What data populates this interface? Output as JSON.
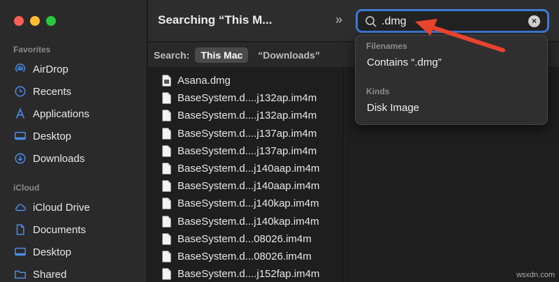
{
  "sidebar": {
    "sections": [
      {
        "title": "Favorites",
        "items": [
          {
            "label": "AirDrop",
            "icon": "airdrop-icon"
          },
          {
            "label": "Recents",
            "icon": "clock-icon"
          },
          {
            "label": "Applications",
            "icon": "applications-icon"
          },
          {
            "label": "Desktop",
            "icon": "desktop-icon"
          },
          {
            "label": "Downloads",
            "icon": "downloads-icon"
          }
        ]
      },
      {
        "title": "iCloud",
        "items": [
          {
            "label": "iCloud Drive",
            "icon": "cloud-icon"
          },
          {
            "label": "Documents",
            "icon": "document-icon"
          },
          {
            "label": "Desktop",
            "icon": "desktop-icon"
          },
          {
            "label": "Shared",
            "icon": "shared-folder-icon"
          }
        ]
      }
    ]
  },
  "toolbar": {
    "title": "Searching “This M...",
    "overflow_glyph": "»",
    "search": {
      "value": ".dmg",
      "clear_glyph": "×"
    }
  },
  "scope": {
    "label": "Search:",
    "options": [
      {
        "label": "This Mac",
        "selected": true
      },
      {
        "label": "“Downloads”",
        "selected": false
      }
    ]
  },
  "files": [
    "Asana.dmg",
    "BaseSystem.d....j132ap.im4m",
    "BaseSystem.d....j132ap.im4m",
    "BaseSystem.d....j137ap.im4m",
    "BaseSystem.d....j137ap.im4m",
    "BaseSystem.d...j140aap.im4m",
    "BaseSystem.d...j140aap.im4m",
    "BaseSystem.d...j140kap.im4m",
    "BaseSystem.d...j140kap.im4m",
    "BaseSystem.d...08026.im4m",
    "BaseSystem.d...08026.im4m",
    "BaseSystem.d....j152fap.im4m"
  ],
  "dropdown": {
    "filenames_header": "Filenames",
    "filenames_item": "Contains “.dmg”",
    "kinds_header": "Kinds",
    "kinds_item": "Disk Image"
  },
  "watermark": "wsxdn.com",
  "colors": {
    "accent": "#3c7ad7",
    "annotation_arrow": "#e8432d",
    "sidebar_icon": "#4a8ef0"
  }
}
